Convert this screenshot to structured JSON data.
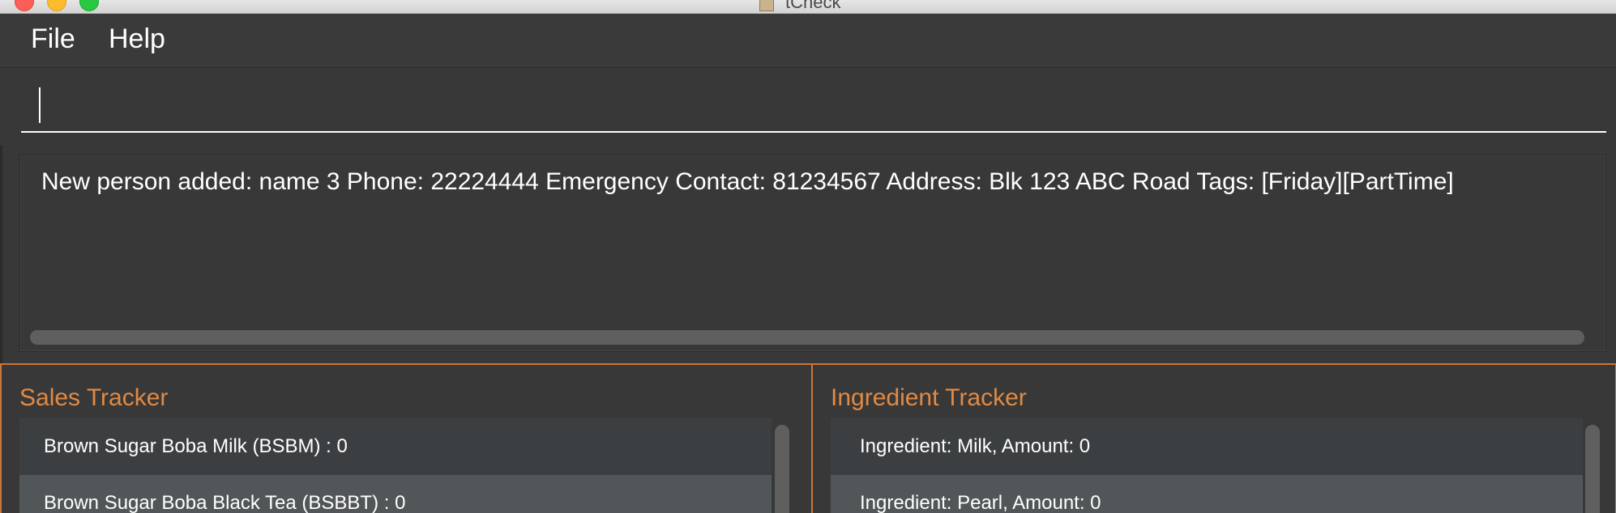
{
  "window": {
    "title": "tCheck"
  },
  "menu": {
    "file_label": "File",
    "help_label": "Help"
  },
  "command_box": {
    "value": "",
    "placeholder": ""
  },
  "result_display": {
    "text": "New person added: name 3 Phone: 22224444 Emergency Contact: 81234567 Address: Blk 123 ABC Road Tags: [Friday][PartTime]"
  },
  "sales_tracker": {
    "title": "Sales Tracker",
    "items": [
      {
        "label": "Brown Sugar Boba Milk (BSBM) : 0"
      },
      {
        "label": "Brown Sugar Boba Black Tea (BSBBT) : 0"
      }
    ]
  },
  "ingredient_tracker": {
    "title": "Ingredient Tracker",
    "items": [
      {
        "label": "Ingredient: Milk,  Amount: 0"
      },
      {
        "label": "Ingredient: Pearl,  Amount: 0"
      }
    ]
  },
  "colors": {
    "background": "#383838",
    "accent_orange": "#e08a45",
    "border_orange": "#c9773a",
    "row_odd": "#3c3f41",
    "row_even": "#515658"
  }
}
